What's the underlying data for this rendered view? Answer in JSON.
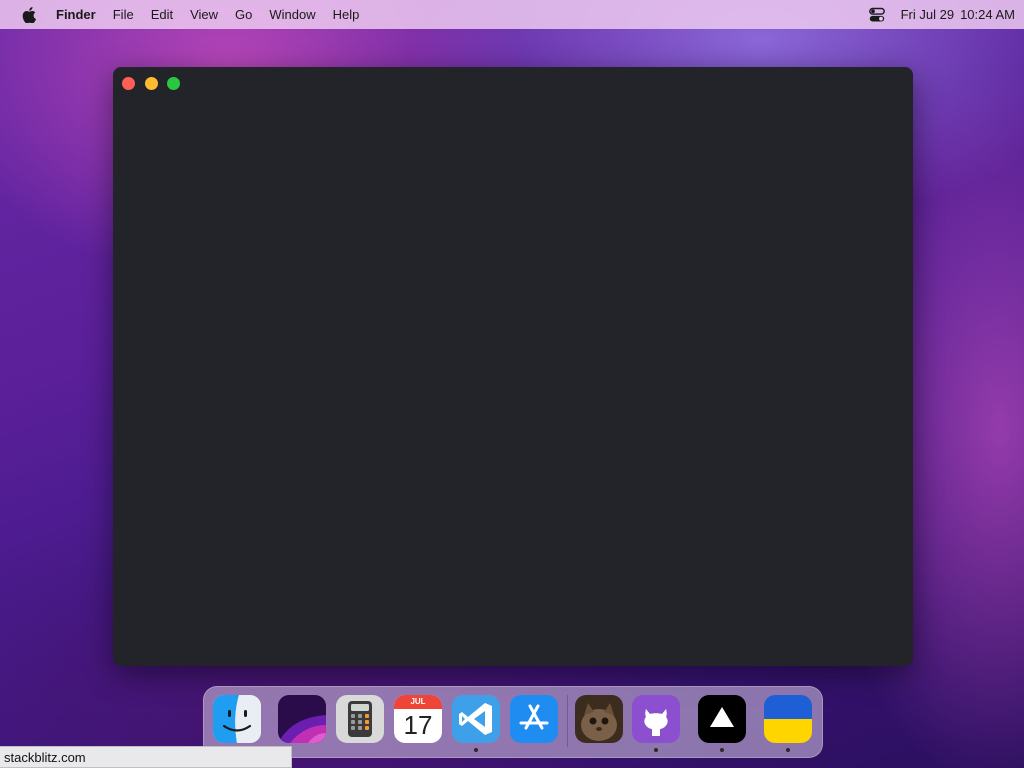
{
  "menubar": {
    "apple_icon": "apple-icon",
    "items": [
      {
        "label": "Finder"
      },
      {
        "label": "File"
      },
      {
        "label": "Edit"
      },
      {
        "label": "View"
      },
      {
        "label": "Go"
      },
      {
        "label": "Window"
      },
      {
        "label": "Help"
      }
    ],
    "control_center_icon": "control-center-icon",
    "date": "Fri Jul 29",
    "time": "10:24 AM"
  },
  "window": {
    "buttons": [
      "close",
      "minimize",
      "zoom"
    ],
    "colors": {
      "close": "#ff5f57",
      "minimize": "#febc2e",
      "zoom": "#28c840",
      "background": "#22242a"
    }
  },
  "dock": {
    "apps": [
      {
        "icon": "finder-icon",
        "running": false
      },
      {
        "icon": "wallpaper-icon",
        "running": false
      },
      {
        "icon": "calculator-icon",
        "running": false
      },
      {
        "icon": "calendar-icon",
        "running": false,
        "month": "JUL",
        "day": "17"
      },
      {
        "icon": "vscode-icon",
        "running": true
      },
      {
        "icon": "app-store-icon",
        "running": false
      },
      {
        "icon": "cat-photo-icon",
        "running": false
      },
      {
        "icon": "github-icon",
        "running": true
      },
      {
        "icon": "vercel-icon",
        "running": true
      },
      {
        "icon": "ukraine-flag-icon",
        "running": true
      }
    ]
  },
  "status_bar": {
    "text": "stackblitz.com"
  }
}
